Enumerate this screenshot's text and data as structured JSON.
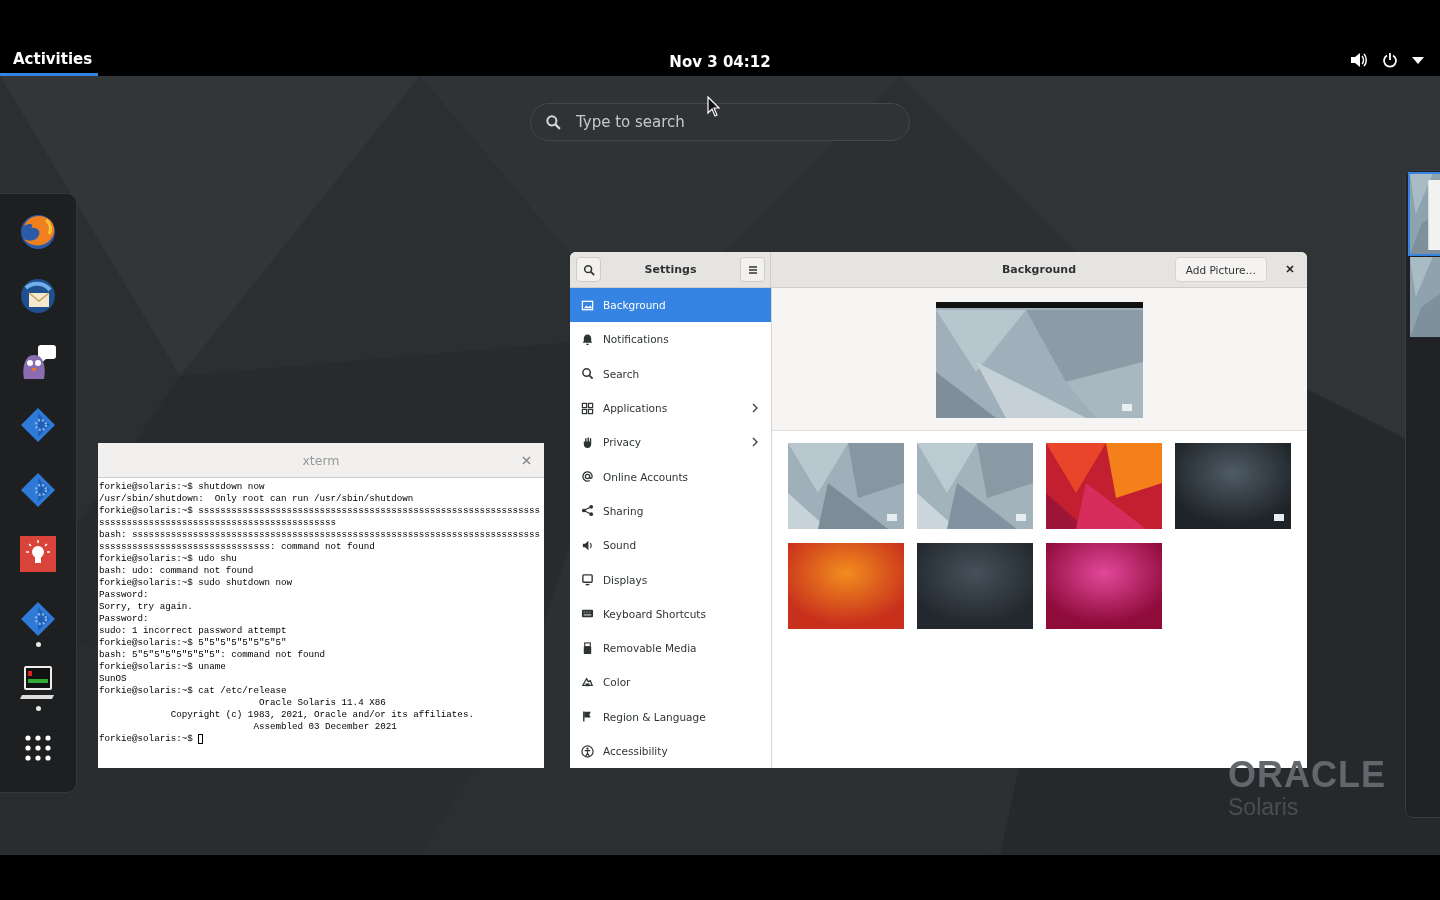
{
  "top_bar": {
    "activities": {
      "label": "Activities",
      "selected": true
    },
    "clock": "Nov 3  04:12"
  },
  "search": {
    "placeholder": "Type to search"
  },
  "dock": [
    {
      "kind": "globe",
      "running": false
    },
    {
      "kind": "envelope",
      "running": false
    },
    {
      "kind": "bird",
      "running": false
    },
    {
      "kind": "diamond",
      "running": false
    },
    {
      "kind": "diamond",
      "running": false
    },
    {
      "kind": "bulb",
      "running": false
    },
    {
      "kind": "diamond",
      "running": true
    },
    {
      "kind": "terminal",
      "running": true
    },
    {
      "kind": "grid",
      "running": false
    }
  ],
  "terminal": {
    "title": "xterm",
    "lines": [
      "forkie@solaris:~$ shutdown now",
      "/usr/sbin/shutdown:  Only root can run /usr/sbin/shutdown",
      "forkie@solaris:~$ ssssssssssssssssssssssssssssssssssssssssssssssssssssssssssssss",
      "sssssssssssssssssssssssssssssssssssssssssss",
      "bash: ssssssssssssssssssssssssssssssssssssssssssssssssssssssssssssssssssssssssss",
      "sssssssssssssssssssssssssssssss: command not found",
      "forkie@solaris:~$ udo shu",
      "bash: udo: command not found",
      "forkie@solaris:~$ sudo shutdown now",
      "Password:",
      "Sorry, try again.",
      "Password:",
      "sudo: 1 incorrect password attempt",
      "forkie@solaris:~$ 5\"5\"5\"5\"5\"5\"5\"5\"",
      "bash: 5\"5\"5\"5\"5\"5\"5\"5\": command not found",
      "forkie@solaris:~$ uname",
      "SunOS",
      "forkie@solaris:~$ cat /etc/release",
      "                             Oracle Solaris 11.4 X86",
      "             Copyright (c) 1983, 2021, Oracle and/or its affiliates.",
      "                            Assembled 03 December 2021",
      "forkie@solaris:~$ "
    ]
  },
  "settings": {
    "title": "Settings",
    "page_title": "Background",
    "add_button": "Add Picture…",
    "sidebar": [
      {
        "label": "Background",
        "selected": true,
        "submenu": false
      },
      {
        "label": "Notifications",
        "selected": false,
        "submenu": false
      },
      {
        "label": "Search",
        "selected": false,
        "submenu": false
      },
      {
        "label": "Applications",
        "selected": false,
        "submenu": true
      },
      {
        "label": "Privacy",
        "selected": false,
        "submenu": true
      },
      {
        "label": "Online Accounts",
        "selected": false,
        "submenu": false
      },
      {
        "label": "Sharing",
        "selected": false,
        "submenu": false
      },
      {
        "label": "Sound",
        "selected": false,
        "submenu": false
      },
      {
        "label": "Displays",
        "selected": false,
        "submenu": false
      },
      {
        "label": "Keyboard Shortcuts",
        "selected": false,
        "submenu": false
      },
      {
        "label": "Removable Media",
        "selected": false,
        "submenu": false
      },
      {
        "label": "Color",
        "selected": false,
        "submenu": false
      },
      {
        "label": "Region & Language",
        "selected": false,
        "submenu": false
      },
      {
        "label": "Accessibility",
        "selected": false,
        "submenu": false
      }
    ]
  },
  "workspaces": [
    {
      "selected": true
    },
    {
      "selected": false
    }
  ],
  "wallpaper_logo": {
    "brand": "ORACLE",
    "product": "Solaris"
  }
}
